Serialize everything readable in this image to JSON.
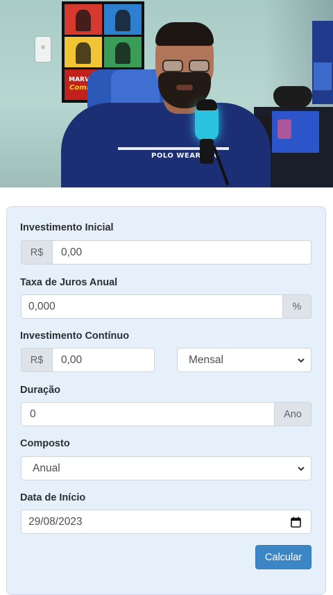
{
  "video": {
    "shirt_text": "POLO WEAR 200",
    "poster_logo_top": "MARVEL",
    "poster_logo_bottom": "Comics"
  },
  "form": {
    "initial_investment": {
      "label": "Investimento Inicial",
      "prefix": "R$",
      "value": "0,00"
    },
    "annual_rate": {
      "label": "Taxa de Juros Anual",
      "value": "0,000",
      "suffix": "%"
    },
    "continuous_investment": {
      "label": "Investimento Contínuo",
      "prefix": "R$",
      "value": "0,00",
      "frequency": "Mensal"
    },
    "duration": {
      "label": "Duração",
      "value": "0",
      "suffix": "Ano"
    },
    "compound": {
      "label": "Composto",
      "value": "Anual"
    },
    "start_date": {
      "label": "Data de Início",
      "value": "29/08/2023"
    },
    "calculate_label": "Calcular"
  },
  "colors": {
    "card_bg": "#e6f0fa",
    "button": "#3d86c6",
    "addon_bg": "#dde3e9"
  },
  "icons": {
    "select_arrow": "chevron-down-icon",
    "date_picker": "calendar-icon"
  }
}
